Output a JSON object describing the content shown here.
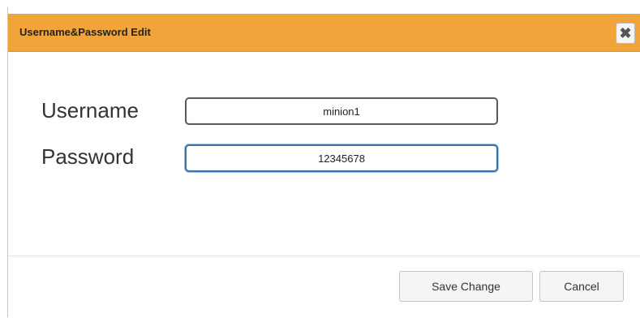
{
  "dialog": {
    "title": "Username&Password Edit",
    "close_symbol": "✖",
    "close_icon": "close-icon"
  },
  "form": {
    "username_label": "Username",
    "username_value": "minion1",
    "password_label": "Password",
    "password_value": "12345678"
  },
  "footer": {
    "save_label": "Save Change",
    "cancel_label": "Cancel"
  },
  "colors": {
    "titlebar": "#f0a43a",
    "focus_border": "#3f6fa8"
  }
}
